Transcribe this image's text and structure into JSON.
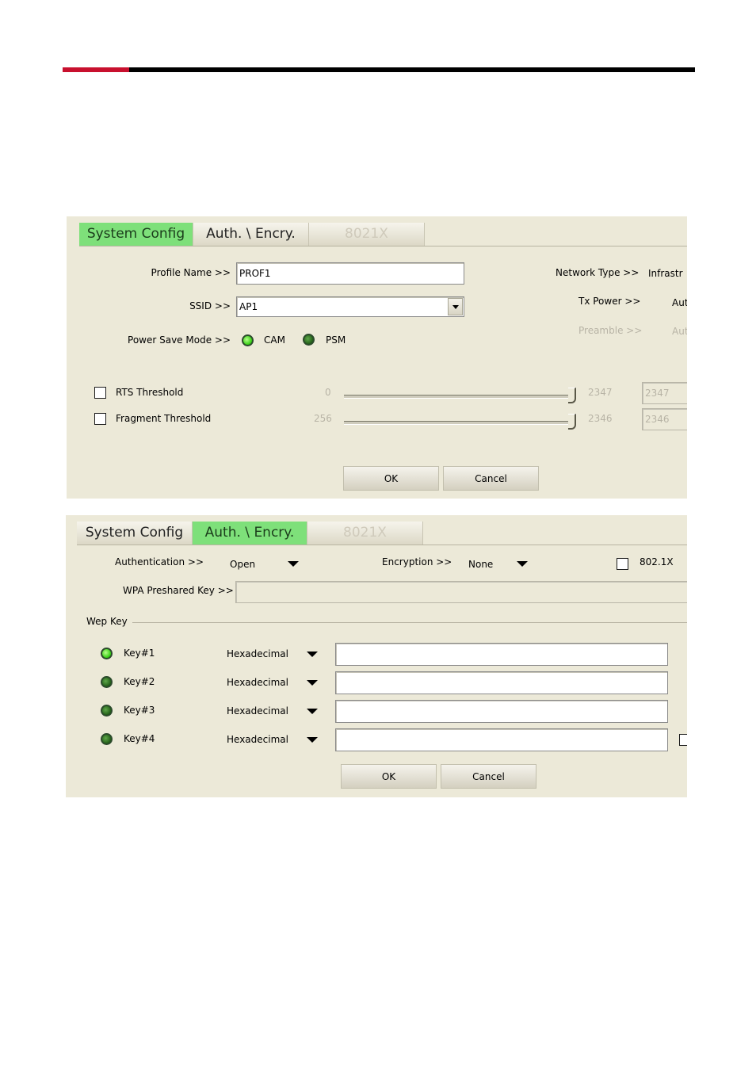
{
  "panel1": {
    "tabs": {
      "system_config": "System Config",
      "auth_encry": "Auth. \\ Encry.",
      "t8021x": "8021X"
    },
    "profile_name": {
      "label": "Profile Name >>",
      "value": "PROF1"
    },
    "ssid": {
      "label": "SSID >>",
      "value": "AP1"
    },
    "power_save": {
      "label": "Power Save Mode >>",
      "cam": "CAM",
      "psm": "PSM",
      "selected": "CAM"
    },
    "network_type": {
      "label": "Network Type >>",
      "value": "Infrastr"
    },
    "tx_power": {
      "label": "Tx Power >>",
      "value": "Aut"
    },
    "preamble": {
      "label": "Preamble >>",
      "value": "Aut"
    },
    "rts": {
      "label": "RTS Threshold",
      "min": "0",
      "max": "2347",
      "value": "2347"
    },
    "fragment": {
      "label": "Fragment Threshold",
      "min": "256",
      "max": "2346",
      "value": "2346"
    },
    "ok": "OK",
    "cancel": "Cancel"
  },
  "panel2": {
    "tabs": {
      "system_config": "System Config",
      "auth_encry": "Auth. \\ Encry.",
      "t8021x": "8021X"
    },
    "authentication": {
      "label": "Authentication >>",
      "value": "Open"
    },
    "encryption": {
      "label": "Encryption >>",
      "value": "None"
    },
    "dot1x": {
      "label": "802.1X"
    },
    "wpa_key": {
      "label": "WPA Preshared Key >>",
      "value": ""
    },
    "wep_key_group": "Wep Key",
    "keys": [
      {
        "label": "Key#1",
        "format": "Hexadecimal",
        "value": "",
        "selected": true
      },
      {
        "label": "Key#2",
        "format": "Hexadecimal",
        "value": "",
        "selected": false
      },
      {
        "label": "Key#3",
        "format": "Hexadecimal",
        "value": "",
        "selected": false
      },
      {
        "label": "Key#4",
        "format": "Hexadecimal",
        "value": "",
        "selected": false
      }
    ],
    "ok": "OK",
    "cancel": "Cancel"
  },
  "colors": {
    "panel_bg": "#ece9d8",
    "active_tab": "#7ee07a",
    "header_red": "#c8102e",
    "header_black": "#000000"
  }
}
